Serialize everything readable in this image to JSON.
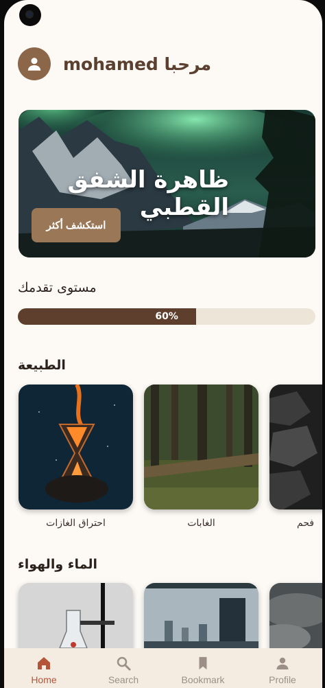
{
  "header": {
    "greeting": "مرحبا mohamed",
    "avatar_icon": "person-icon"
  },
  "hero": {
    "title": "ظاهرة الشفق القطبي",
    "button_label": "استكشف أكثر"
  },
  "progress": {
    "label": "مستوى تقدمك",
    "value_text": "60%",
    "value": 0.6
  },
  "sections": [
    {
      "title": "الطبيعة",
      "cards": [
        {
          "label": "احتراق الغازات"
        },
        {
          "label": "الغابات"
        },
        {
          "label": "فحم"
        }
      ]
    },
    {
      "title": "الماء والهواء",
      "cards": [
        {
          "label": ""
        },
        {
          "label": ""
        },
        {
          "label": ""
        }
      ]
    }
  ],
  "nav": {
    "items": [
      {
        "label": "Home",
        "icon": "home-icon"
      },
      {
        "label": "Search",
        "icon": "search-icon"
      },
      {
        "label": "Bookmark",
        "icon": "bookmark-icon"
      },
      {
        "label": "Profile",
        "icon": "person-icon"
      }
    ],
    "active_color": "#b4553a",
    "inactive_color": "#9b8f87"
  },
  "colors": {
    "brand_brown": "#5e3f2e",
    "accent_brown": "#9a7757",
    "background": "#fdfaf6"
  }
}
